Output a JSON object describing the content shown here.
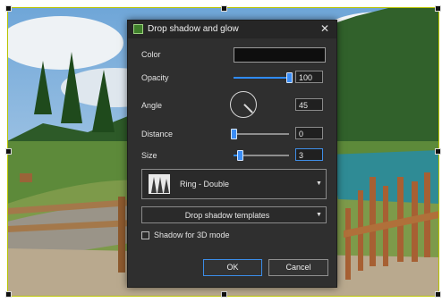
{
  "dialog": {
    "title": "Drop shadow and glow",
    "app_icon": "image-effect-icon",
    "close_icon": "close-icon",
    "color_label": "Color",
    "color_value": "#0e0e0e",
    "opacity": {
      "label": "Opacity",
      "value": "100",
      "fraction": 1.0
    },
    "angle": {
      "label": "Angle",
      "value": "45"
    },
    "distance": {
      "label": "Distance",
      "value": "0",
      "fraction": 0.0
    },
    "size": {
      "label": "Size",
      "value": "3",
      "fraction": 0.12
    },
    "preset": {
      "label": "Ring - Double",
      "thumbnail_icon": "ring-double-preset-icon"
    },
    "templates_label": "Drop shadow templates",
    "shadow_3d_label": "Shadow for 3D mode",
    "shadow_3d_checked": false,
    "ok_label": "OK",
    "cancel_label": "Cancel"
  },
  "accent_color": "#3b8df5",
  "selection_frame_color": "#b9c400"
}
